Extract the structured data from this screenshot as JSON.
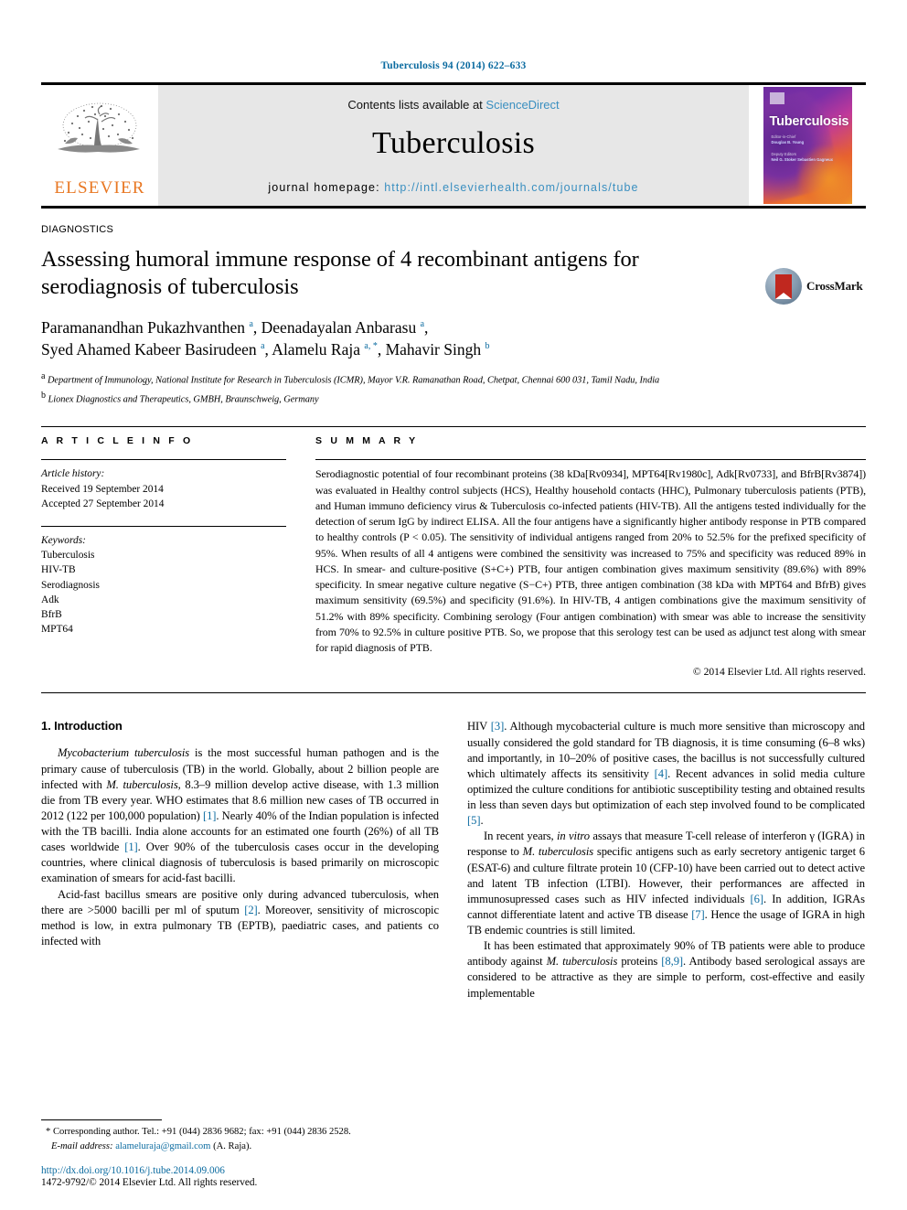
{
  "running_head": "Tuberculosis 94 (2014) 622–633",
  "banner": {
    "publisher_logo_text": "ELSEVIER",
    "contents_prefix": "Contents lists available at",
    "contents_link": "ScienceDirect",
    "journal_title": "Tuberculosis",
    "homepage_prefix": "journal homepage:",
    "homepage_url": "http://intl.elsevierhealth.com/journals/tube",
    "cover": {
      "title": "Tuberculosis",
      "line1": "Editor-in-Chief",
      "line2": "Douglas B. Young",
      "line3": "Deputy Editors",
      "line4": "Neil G. Stoker  Sebastien Gagneux"
    }
  },
  "article": {
    "category": "DIAGNOSTICS",
    "crossmark_label": "CrossMark",
    "title": "Assessing humoral immune response of 4 recombinant antigens for serodiagnosis of tuberculosis",
    "authors_line1": "Paramanandhan Pukazhvanthen a, Deenadayalan Anbarasu a,",
    "authors_line2": "Syed Ahamed Kabeer Basirudeen a, Alamelu Raja a, *, Mahavir Singh b",
    "affiliation_a": "Department of Immunology, National Institute for Research in Tuberculosis (ICMR), Mayor V.R. Ramanathan Road, Chetpat, Chennai 600 031, Tamil Nadu, India",
    "affiliation_b": "Lionex Diagnostics and Therapeutics, GMBH, Braunschweig, Germany"
  },
  "info": {
    "head": "A R T I C L E  I N F O",
    "history_label": "Article history:",
    "received": "Received 19 September 2014",
    "accepted": "Accepted 27 September 2014",
    "keywords_label": "Keywords:",
    "keywords": [
      "Tuberculosis",
      "HIV-TB",
      "Serodiagnosis",
      "Adk",
      "BfrB",
      "MPT64"
    ]
  },
  "summary": {
    "head": "S U M M A R Y",
    "text": "Serodiagnostic potential of four recombinant proteins (38 kDa[Rv0934], MPT64[Rv1980c], Adk[Rv0733], and BfrB[Rv3874]) was evaluated in Healthy control subjects (HCS), Healthy household contacts (HHC), Pulmonary tuberculosis patients (PTB), and Human immuno deficiency virus & Tuberculosis co-infected patients (HIV-TB). All the antigens tested individually for the detection of serum IgG by indirect ELISA. All the four antigens have a significantly higher antibody response in PTB compared to healthy controls (P < 0.05). The sensitivity of individual antigens ranged from 20% to 52.5% for the prefixed specificity of 95%. When results of all 4 antigens were combined the sensitivity was increased to 75% and specificity was reduced 89% in HCS. In smear- and culture-positive (S+C+) PTB, four antigen combination gives maximum sensitivity (89.6%) with 89% specificity. In smear negative culture negative (S−C+) PTB, three antigen combination (38 kDa with MPT64 and BfrB) gives maximum sensitivity (69.5%) and specificity (91.6%). In HIV-TB, 4 antigen combinations give the maximum sensitivity of 51.2% with 89% specificity. Combining serology (Four antigen combination) with smear was able to increase the sensitivity from 70% to 92.5% in culture positive PTB. So, we propose that this serology test can be used as adjunct test along with smear for rapid diagnosis of PTB.",
    "copyright": "© 2014 Elsevier Ltd. All rights reserved."
  },
  "intro": {
    "heading": "1. Introduction",
    "left_paragraphs": [
      "Mycobacterium tuberculosis is the most successful human pathogen and is the primary cause of tuberculosis (TB) in the world. Globally, about 2 billion people are infected with M. tuberculosis, 8.3–9 million develop active disease, with 1.3 million die from TB every year. WHO estimates that 8.6 million new cases of TB occurred in 2012 (122 per 100,000 population) [1]. Nearly 40% of the Indian population is infected with the TB bacilli. India alone accounts for an estimated one fourth (26%) of all TB cases worldwide [1]. Over 90% of the tuberculosis cases occur in the developing countries, where clinical diagnosis of tuberculosis is based primarily on microscopic examination of smears for acid-fast bacilli.",
      "Acid-fast bacillus smears are positive only during advanced tuberculosis, when there are >5000 bacilli per ml of sputum [2]. Moreover, sensitivity of microscopic method is low, in extra pulmonary TB (EPTB), paediatric cases, and patients co infected with"
    ],
    "right_paragraphs": [
      "HIV [3]. Although mycobacterial culture is much more sensitive than microscopy and usually considered the gold standard for TB diagnosis, it is time consuming (6–8 wks) and importantly, in 10–20% of positive cases, the bacillus is not successfully cultured which ultimately affects its sensitivity [4]. Recent advances in solid media culture optimized the culture conditions for antibiotic susceptibility testing and obtained results in less than seven days but optimization of each step involved found to be complicated [5].",
      "In recent years, in vitro assays that measure T-cell release of interferon γ (IGRA) in response to M. tuberculosis specific antigens such as early secretory antigenic target 6 (ESAT-6) and culture filtrate protein 10 (CFP-10) have been carried out to detect active and latent TB infection (LTBI). However, their performances are affected in immunosupressed cases such as HIV infected individuals [6]. In addition, IGRAs cannot differentiate latent and active TB disease [7]. Hence the usage of IGRA in high TB endemic countries is still limited.",
      "It has been estimated that approximately 90% of TB patients were able to produce antibody against M. tuberculosis proteins [8,9]. Antibody based serological assays are considered to be attractive as they are simple to perform, cost-effective and easily implementable"
    ]
  },
  "footer": {
    "corresponding_marker": "*",
    "corresponding_text": "Corresponding author. Tel.: +91 (044) 2836 9682; fax: +91 (044) 2836 2528.",
    "email_label": "E-mail address:",
    "email": "alameluraja@gmail.com",
    "email_suffix": "(A. Raja).",
    "doi": "http://dx.doi.org/10.1016/j.tube.2014.09.006",
    "issn_line": "1472-9792/© 2014 Elsevier Ltd. All rights reserved."
  },
  "colors": {
    "link": "#0b6ba0",
    "elsevier_orange": "#e87722",
    "banner_bg": "#e7e7e7"
  }
}
